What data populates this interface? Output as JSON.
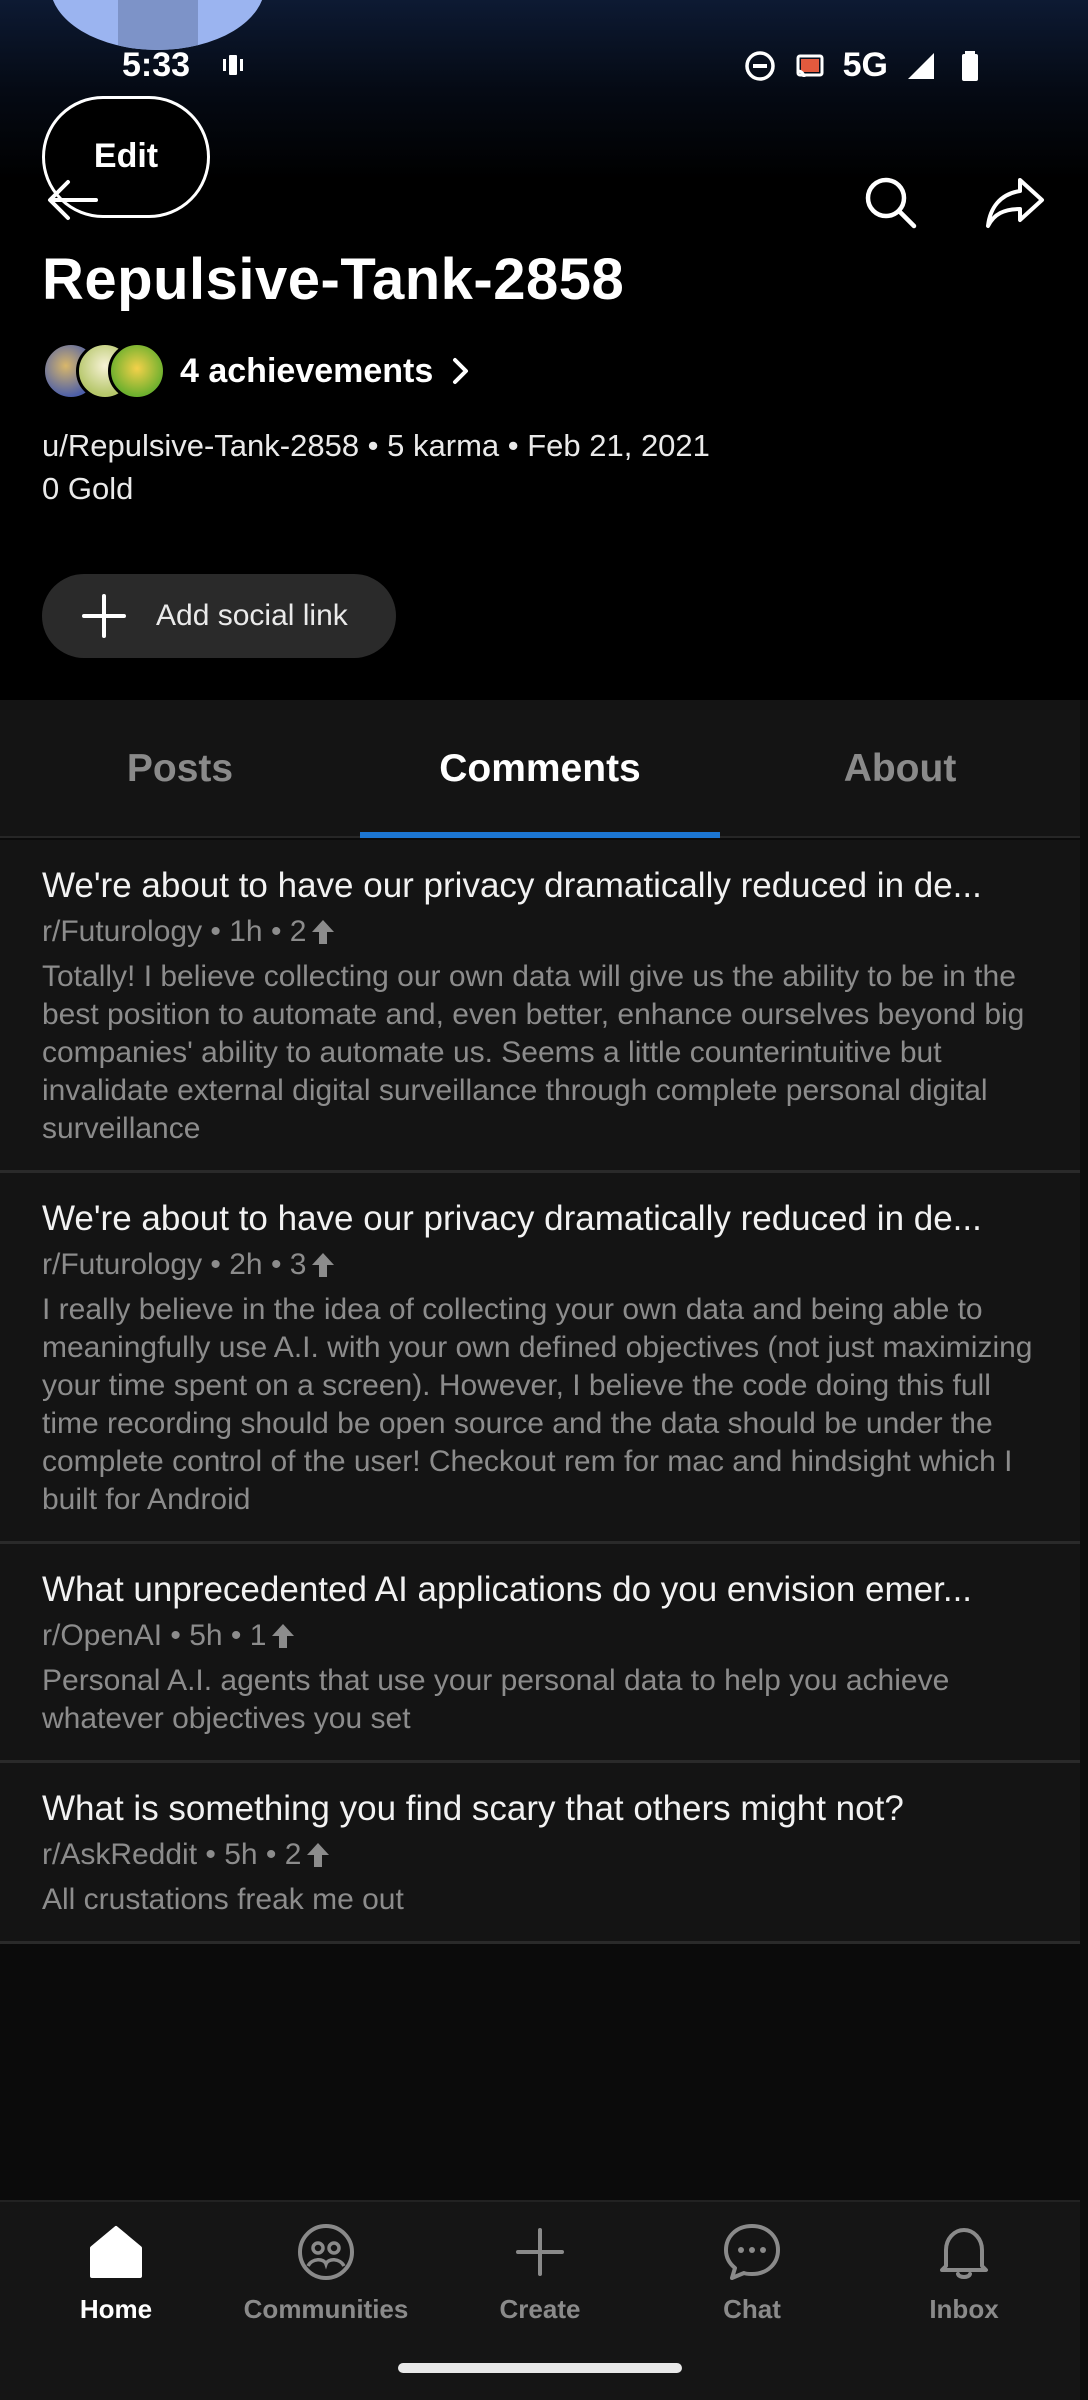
{
  "status_bar": {
    "time": "5:33",
    "network": "5G"
  },
  "header": {
    "edit_label": "Edit",
    "username": "Repulsive-Tank-2858",
    "achievements_label": "4 achievements",
    "meta_line": "u/Repulsive-Tank-2858 • 5 karma • Feb 21, 2021",
    "gold_line": "0 Gold",
    "add_social_label": "Add social link"
  },
  "tabs": [
    {
      "label": "Posts",
      "selected": false
    },
    {
      "label": "Comments",
      "selected": true
    },
    {
      "label": "About",
      "selected": false
    }
  ],
  "comments": [
    {
      "title": "We're about to have our privacy dramatically reduced in de...",
      "meta": "r/Futurology • 1h • 2",
      "body": "Totally! I believe collecting our own data will give us the ability to be in the best position to automate and, even better, enhance ourselves beyond big companies' ability to automate us. Seems a little counterintuitive but invalidate external digital surveillance through complete personal digital surveillance"
    },
    {
      "title": "We're about to have our privacy dramatically reduced in de...",
      "meta": "r/Futurology • 2h • 3",
      "body": "I really believe in the idea of collecting your own data and being able to meaningfully use A.I. with your own defined objectives (not just maximizing your time spent on a screen). However, I believe the code doing this full time recording should be open source and the data should be under the complete control of the user!  Checkout rem for mac and hindsight which I built for Android"
    },
    {
      "title": "What unprecedented AI applications do you envision emer...",
      "meta": "r/OpenAI • 5h • 1",
      "body": "Personal A.I. agents that use your personal data to help you achieve whatever objectives you set"
    },
    {
      "title": "What is something you find scary that others might not?",
      "meta": "r/AskReddit • 5h • 2",
      "body": "All crustations freak me out"
    }
  ],
  "bottom_nav": [
    {
      "label": "Home",
      "icon": "home-icon",
      "active": true
    },
    {
      "label": "Communities",
      "icon": "communities-icon",
      "active": false
    },
    {
      "label": "Create",
      "icon": "plus-icon",
      "active": false
    },
    {
      "label": "Chat",
      "icon": "chat-icon",
      "active": false
    },
    {
      "label": "Inbox",
      "icon": "bell-icon",
      "active": false
    }
  ],
  "colors": {
    "accent": "#1c76d2",
    "background": "#0b0b0b",
    "card": "#141414",
    "muted_text": "#8c8c8c"
  }
}
